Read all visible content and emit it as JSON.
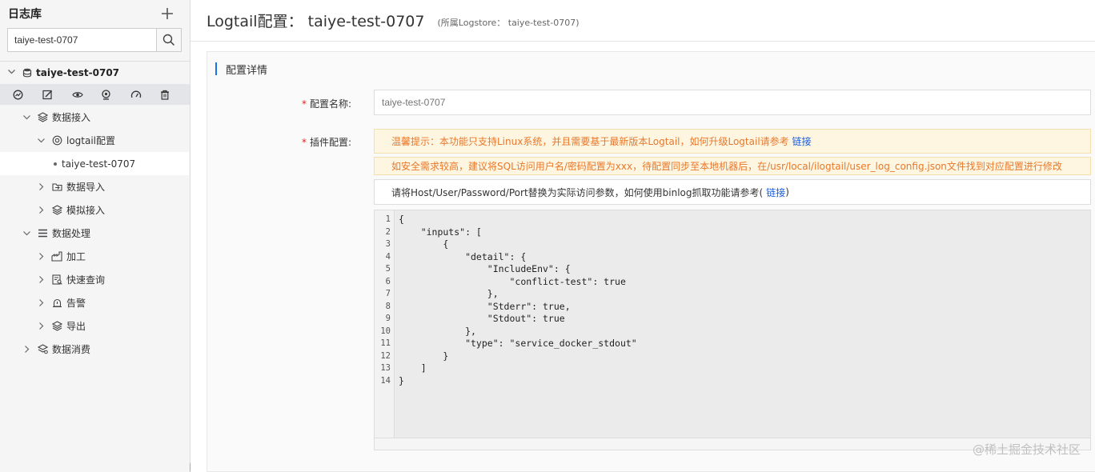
{
  "sidebar": {
    "title": "日志库",
    "search_value": "taiye-test-0707",
    "root_label": "taiye-test-0707",
    "items": [
      {
        "label": "数据接入"
      },
      {
        "label": "logtail配置"
      },
      {
        "label": "taiye-test-0707"
      },
      {
        "label": "数据导入"
      },
      {
        "label": "模拟接入"
      },
      {
        "label": "数据处理"
      },
      {
        "label": "加工"
      },
      {
        "label": "快速查询"
      },
      {
        "label": "告警"
      },
      {
        "label": "导出"
      },
      {
        "label": "数据消费"
      }
    ]
  },
  "header": {
    "title": "Logtail配置： taiye-test-0707",
    "subtitle": "(所属Logstore： taiye-test-0707)"
  },
  "section": {
    "title": "配置详情"
  },
  "form": {
    "name_label": "配置名称:",
    "name_placeholder": "taiye-test-0707",
    "plugin_label": "插件配置:",
    "tip1": "温馨提示：本功能只支持Linux系统，并且需要基于最新版本Logtail，如何升级Logtail请参考",
    "tip1_link": "链接",
    "tip2": "如安全需求较高，建议将SQL访问用户名/密码配置为xxx，待配置同步至本地机器后，在/usr/local/ilogtail/user_log_config.json文件找到对应配置进行修改",
    "tip3": "请将Host/User/Password/Port替换为实际访问参数，如何使用binlog抓取功能请参考(",
    "tip3_link": "链接",
    "tip3_end": ")"
  },
  "editor": {
    "line_numbers": [
      "1",
      "2",
      "3",
      "4",
      "5",
      "6",
      "7",
      "8",
      "9",
      "10",
      "11",
      "12",
      "13",
      "14"
    ],
    "lines": [
      "{",
      "    \"inputs\": [",
      "        {",
      "            \"detail\": {",
      "                \"IncludeEnv\": {",
      "                    \"conflict-test\": true",
      "                },",
      "                \"Stderr\": true,",
      "                \"Stdout\": true",
      "            },",
      "            \"type\": \"service_docker_stdout\"",
      "        }",
      "    ]",
      "}"
    ]
  },
  "watermark": "@稀土掘金技术社区",
  "colors": {
    "accent": "#1a73e8",
    "warn_text": "#e8782c",
    "warn_bg": "#fef6e0",
    "link": "#1a5bd6",
    "required": "#e02020"
  }
}
